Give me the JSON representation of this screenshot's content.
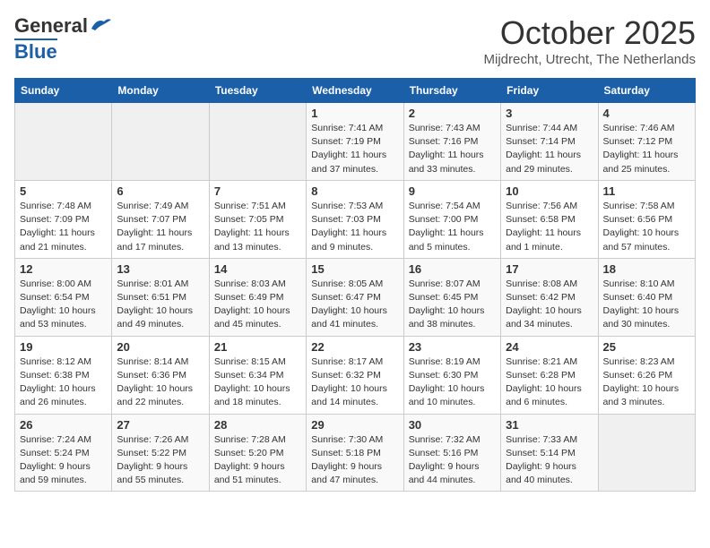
{
  "header": {
    "logo_general": "General",
    "logo_blue": "Blue",
    "month_title": "October 2025",
    "location": "Mijdrecht, Utrecht, The Netherlands"
  },
  "days_of_week": [
    "Sunday",
    "Monday",
    "Tuesday",
    "Wednesday",
    "Thursday",
    "Friday",
    "Saturday"
  ],
  "weeks": [
    [
      {
        "day": "",
        "empty": true
      },
      {
        "day": "",
        "empty": true
      },
      {
        "day": "",
        "empty": true
      },
      {
        "day": "1",
        "sunrise": "7:41 AM",
        "sunset": "7:19 PM",
        "daylight": "11 hours and 37 minutes."
      },
      {
        "day": "2",
        "sunrise": "7:43 AM",
        "sunset": "7:16 PM",
        "daylight": "11 hours and 33 minutes."
      },
      {
        "day": "3",
        "sunrise": "7:44 AM",
        "sunset": "7:14 PM",
        "daylight": "11 hours and 29 minutes."
      },
      {
        "day": "4",
        "sunrise": "7:46 AM",
        "sunset": "7:12 PM",
        "daylight": "11 hours and 25 minutes."
      }
    ],
    [
      {
        "day": "5",
        "sunrise": "7:48 AM",
        "sunset": "7:09 PM",
        "daylight": "11 hours and 21 minutes."
      },
      {
        "day": "6",
        "sunrise": "7:49 AM",
        "sunset": "7:07 PM",
        "daylight": "11 hours and 17 minutes."
      },
      {
        "day": "7",
        "sunrise": "7:51 AM",
        "sunset": "7:05 PM",
        "daylight": "11 hours and 13 minutes."
      },
      {
        "day": "8",
        "sunrise": "7:53 AM",
        "sunset": "7:03 PM",
        "daylight": "11 hours and 9 minutes."
      },
      {
        "day": "9",
        "sunrise": "7:54 AM",
        "sunset": "7:00 PM",
        "daylight": "11 hours and 5 minutes."
      },
      {
        "day": "10",
        "sunrise": "7:56 AM",
        "sunset": "6:58 PM",
        "daylight": "11 hours and 1 minute."
      },
      {
        "day": "11",
        "sunrise": "7:58 AM",
        "sunset": "6:56 PM",
        "daylight": "10 hours and 57 minutes."
      }
    ],
    [
      {
        "day": "12",
        "sunrise": "8:00 AM",
        "sunset": "6:54 PM",
        "daylight": "10 hours and 53 minutes."
      },
      {
        "day": "13",
        "sunrise": "8:01 AM",
        "sunset": "6:51 PM",
        "daylight": "10 hours and 49 minutes."
      },
      {
        "day": "14",
        "sunrise": "8:03 AM",
        "sunset": "6:49 PM",
        "daylight": "10 hours and 45 minutes."
      },
      {
        "day": "15",
        "sunrise": "8:05 AM",
        "sunset": "6:47 PM",
        "daylight": "10 hours and 41 minutes."
      },
      {
        "day": "16",
        "sunrise": "8:07 AM",
        "sunset": "6:45 PM",
        "daylight": "10 hours and 38 minutes."
      },
      {
        "day": "17",
        "sunrise": "8:08 AM",
        "sunset": "6:42 PM",
        "daylight": "10 hours and 34 minutes."
      },
      {
        "day": "18",
        "sunrise": "8:10 AM",
        "sunset": "6:40 PM",
        "daylight": "10 hours and 30 minutes."
      }
    ],
    [
      {
        "day": "19",
        "sunrise": "8:12 AM",
        "sunset": "6:38 PM",
        "daylight": "10 hours and 26 minutes."
      },
      {
        "day": "20",
        "sunrise": "8:14 AM",
        "sunset": "6:36 PM",
        "daylight": "10 hours and 22 minutes."
      },
      {
        "day": "21",
        "sunrise": "8:15 AM",
        "sunset": "6:34 PM",
        "daylight": "10 hours and 18 minutes."
      },
      {
        "day": "22",
        "sunrise": "8:17 AM",
        "sunset": "6:32 PM",
        "daylight": "10 hours and 14 minutes."
      },
      {
        "day": "23",
        "sunrise": "8:19 AM",
        "sunset": "6:30 PM",
        "daylight": "10 hours and 10 minutes."
      },
      {
        "day": "24",
        "sunrise": "8:21 AM",
        "sunset": "6:28 PM",
        "daylight": "10 hours and 6 minutes."
      },
      {
        "day": "25",
        "sunrise": "8:23 AM",
        "sunset": "6:26 PM",
        "daylight": "10 hours and 3 minutes."
      }
    ],
    [
      {
        "day": "26",
        "sunrise": "7:24 AM",
        "sunset": "5:24 PM",
        "daylight": "9 hours and 59 minutes."
      },
      {
        "day": "27",
        "sunrise": "7:26 AM",
        "sunset": "5:22 PM",
        "daylight": "9 hours and 55 minutes."
      },
      {
        "day": "28",
        "sunrise": "7:28 AM",
        "sunset": "5:20 PM",
        "daylight": "9 hours and 51 minutes."
      },
      {
        "day": "29",
        "sunrise": "7:30 AM",
        "sunset": "5:18 PM",
        "daylight": "9 hours and 47 minutes."
      },
      {
        "day": "30",
        "sunrise": "7:32 AM",
        "sunset": "5:16 PM",
        "daylight": "9 hours and 44 minutes."
      },
      {
        "day": "31",
        "sunrise": "7:33 AM",
        "sunset": "5:14 PM",
        "daylight": "9 hours and 40 minutes."
      },
      {
        "day": "",
        "empty": true
      }
    ]
  ]
}
